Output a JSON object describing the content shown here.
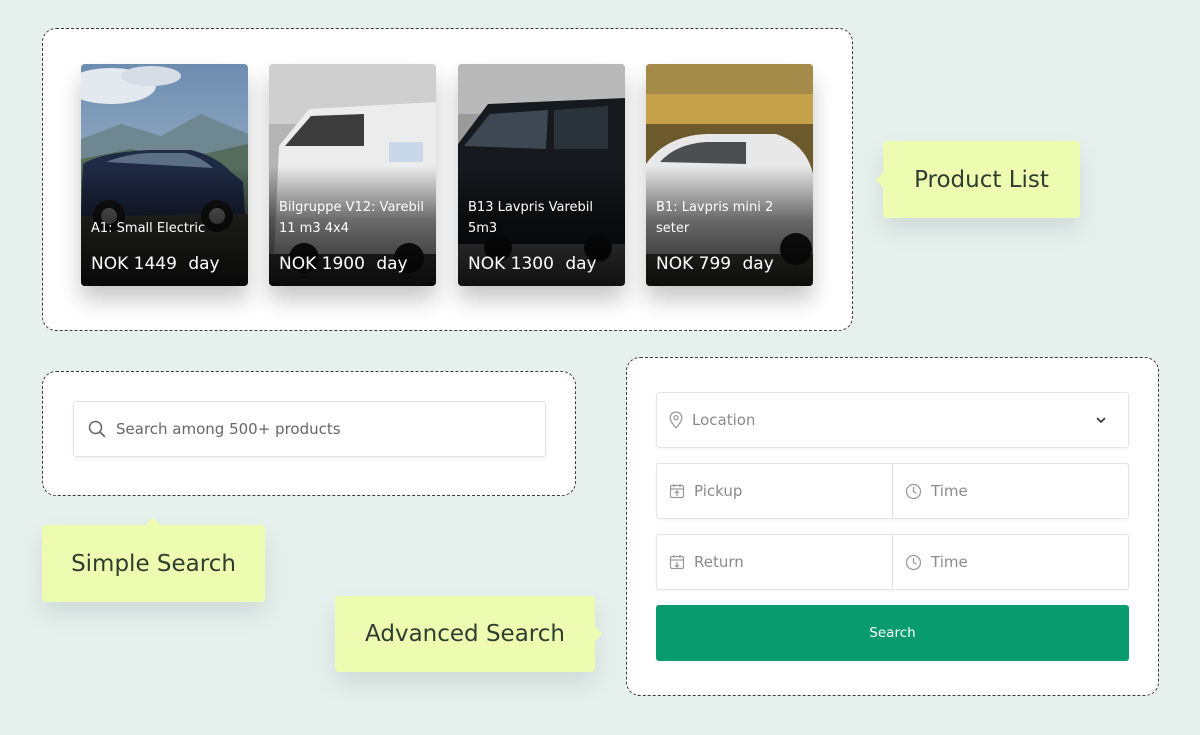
{
  "products": [
    {
      "title": "A1: Small Electric",
      "currency": "NOK",
      "amount": "1449",
      "unit": "day"
    },
    {
      "title": "Bilgruppe V12: Varebil 11 m3 4x4",
      "currency": "NOK",
      "amount": "1900",
      "unit": "day"
    },
    {
      "title": "B13 Lavpris Varebil 5m3",
      "currency": "NOK",
      "amount": "1300",
      "unit": "day"
    },
    {
      "title": "B1: Lavpris mini 2 seter",
      "currency": "NOK",
      "amount": "799",
      "unit": "day"
    }
  ],
  "callouts": {
    "product_list": "Product List",
    "simple_search": "Simple Search",
    "advanced_search": "Advanced Search"
  },
  "simple_search": {
    "placeholder": "Search among 500+ products",
    "icon": "search-icon"
  },
  "advanced_search": {
    "location_placeholder": "Location",
    "pickup_placeholder": "Pickup",
    "pickup_time_placeholder": "Time",
    "return_placeholder": "Return",
    "return_time_placeholder": "Time",
    "search_label": "Search",
    "button_color": "#079b6d"
  },
  "colors": {
    "background": "#e6f1ee",
    "callout": "#eefcb2",
    "accent": "#079b6d"
  }
}
